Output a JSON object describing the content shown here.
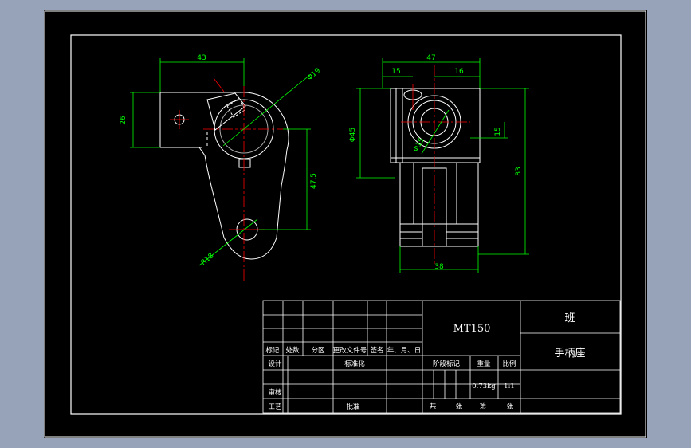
{
  "dimensions": {
    "left_width": "43",
    "left_height": "26",
    "left_diameter": "Φ19",
    "left_center_distance": "47.5",
    "left_radius": "R18",
    "right_width_top": "47",
    "right_left_offset": "15",
    "right_right_offset": "16",
    "right_height": "Φ45",
    "right_hole": "Φ15",
    "right_offset_vertical": "15",
    "right_total_height": "83",
    "right_base_width": "38"
  },
  "title_block": {
    "drawing_number": "MT150",
    "class_label": "班",
    "part_name": "手柄座",
    "header_labels": [
      "标记",
      "处数",
      "分区",
      "更改文件号",
      "签名",
      "年、月、日"
    ],
    "row_design": "设计",
    "row_standardize": "标准化",
    "row_review": "审核",
    "row_process": "工艺",
    "row_approve": "批准",
    "stage_mark": "阶段标记",
    "weight_label": "重量",
    "scale_label": "比例",
    "weight_value": "0.73kg",
    "scale_value": "1:1",
    "sheets_total": "共",
    "sheets_unit1": "张",
    "sheets_num": "第",
    "sheets_unit2": "张"
  },
  "colors": {
    "background": "#97a3b8",
    "sheet": "#000000",
    "outline": "#ffffff",
    "dimension": "#00ff00",
    "centerline": "#ff0000"
  }
}
